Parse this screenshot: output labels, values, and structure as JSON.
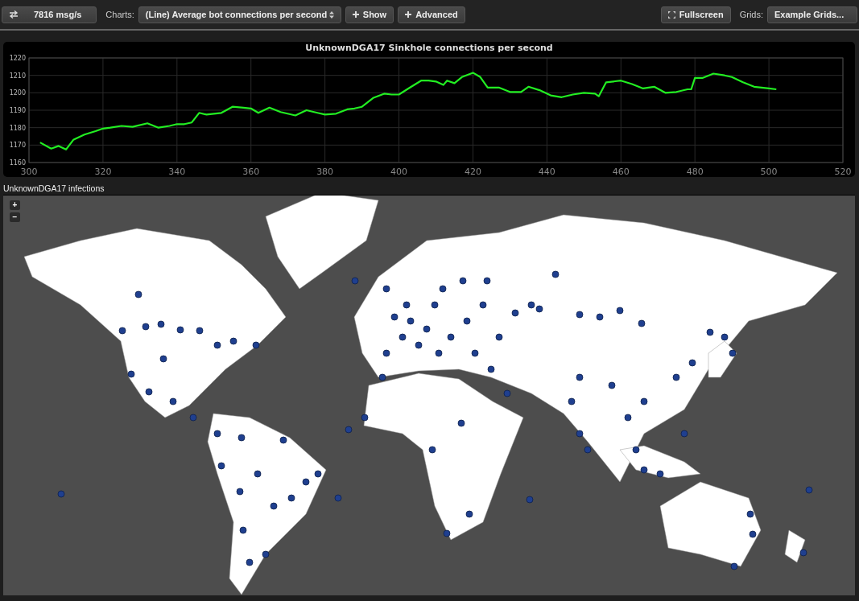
{
  "toolbar": {
    "rate_button": "7816 msg/s",
    "charts_label": "Charts:",
    "chart_select": "(Line) Average bot connections per second",
    "show_button": "Show",
    "advanced_button": "Advanced",
    "fullscreen_button": "Fullscreen",
    "grids_label": "Grids:",
    "grids_select": "Example Grids..."
  },
  "chart_panel": {
    "chart_data": {
      "type": "line",
      "title": "UnknownDGA17 Sinkhole connections per second",
      "grid": true,
      "xlim": [
        300,
        520
      ],
      "ylim": [
        1160,
        1220
      ],
      "xticks": [
        300,
        320,
        340,
        360,
        380,
        400,
        420,
        440,
        460,
        480,
        500,
        520
      ],
      "yticks": [
        1160,
        1170,
        1180,
        1190,
        1200,
        1210,
        1220
      ],
      "x": [
        303,
        306,
        308,
        310,
        312,
        315,
        318,
        320,
        322,
        325,
        328,
        332,
        335,
        338,
        340,
        342,
        344,
        346,
        348,
        352,
        355,
        358,
        360,
        362,
        365,
        368,
        372,
        375,
        378,
        380,
        383,
        386,
        388,
        390,
        393,
        396,
        398,
        400,
        403,
        406,
        408,
        410,
        412,
        413,
        415,
        417,
        420,
        422,
        424,
        427,
        430,
        433,
        435,
        438,
        441,
        444,
        447,
        450,
        453,
        454,
        456,
        460,
        463,
        466,
        469,
        472,
        475,
        478,
        479,
        480,
        482,
        485,
        488,
        490,
        493,
        496,
        500,
        502
      ],
      "series": [
        {
          "color": "#22ee22",
          "values": [
            1171.5,
            1168,
            1169.5,
            1167.5,
            1173,
            1176,
            1178,
            1179.5,
            1180,
            1181,
            1180.5,
            1182.5,
            1180,
            1181,
            1182,
            1182,
            1183,
            1188.5,
            1187.5,
            1188.5,
            1192,
            1191.5,
            1191,
            1188.5,
            1191.5,
            1189,
            1187,
            1190,
            1188.5,
            1187.5,
            1188,
            1190.5,
            1191,
            1192,
            1197,
            1199.5,
            1199,
            1199,
            1203,
            1207,
            1207,
            1206.5,
            1204.5,
            1207,
            1205.5,
            1209,
            1211.5,
            1209,
            1203,
            1203,
            1200.5,
            1200.5,
            1203.5,
            1201.5,
            1198.5,
            1197.5,
            1199,
            1200,
            1199.5,
            1198,
            1206,
            1207,
            1205,
            1202.5,
            1203.5,
            1200,
            1200.5,
            1202,
            1202,
            1208.5,
            1208.5,
            1211,
            1210,
            1209,
            1206,
            1203.5,
            1202.5,
            1202
          ]
        }
      ]
    }
  },
  "map_panel": {
    "title": "UnknownDGA17 infections",
    "zoom_in": "+",
    "zoom_out": "−"
  }
}
